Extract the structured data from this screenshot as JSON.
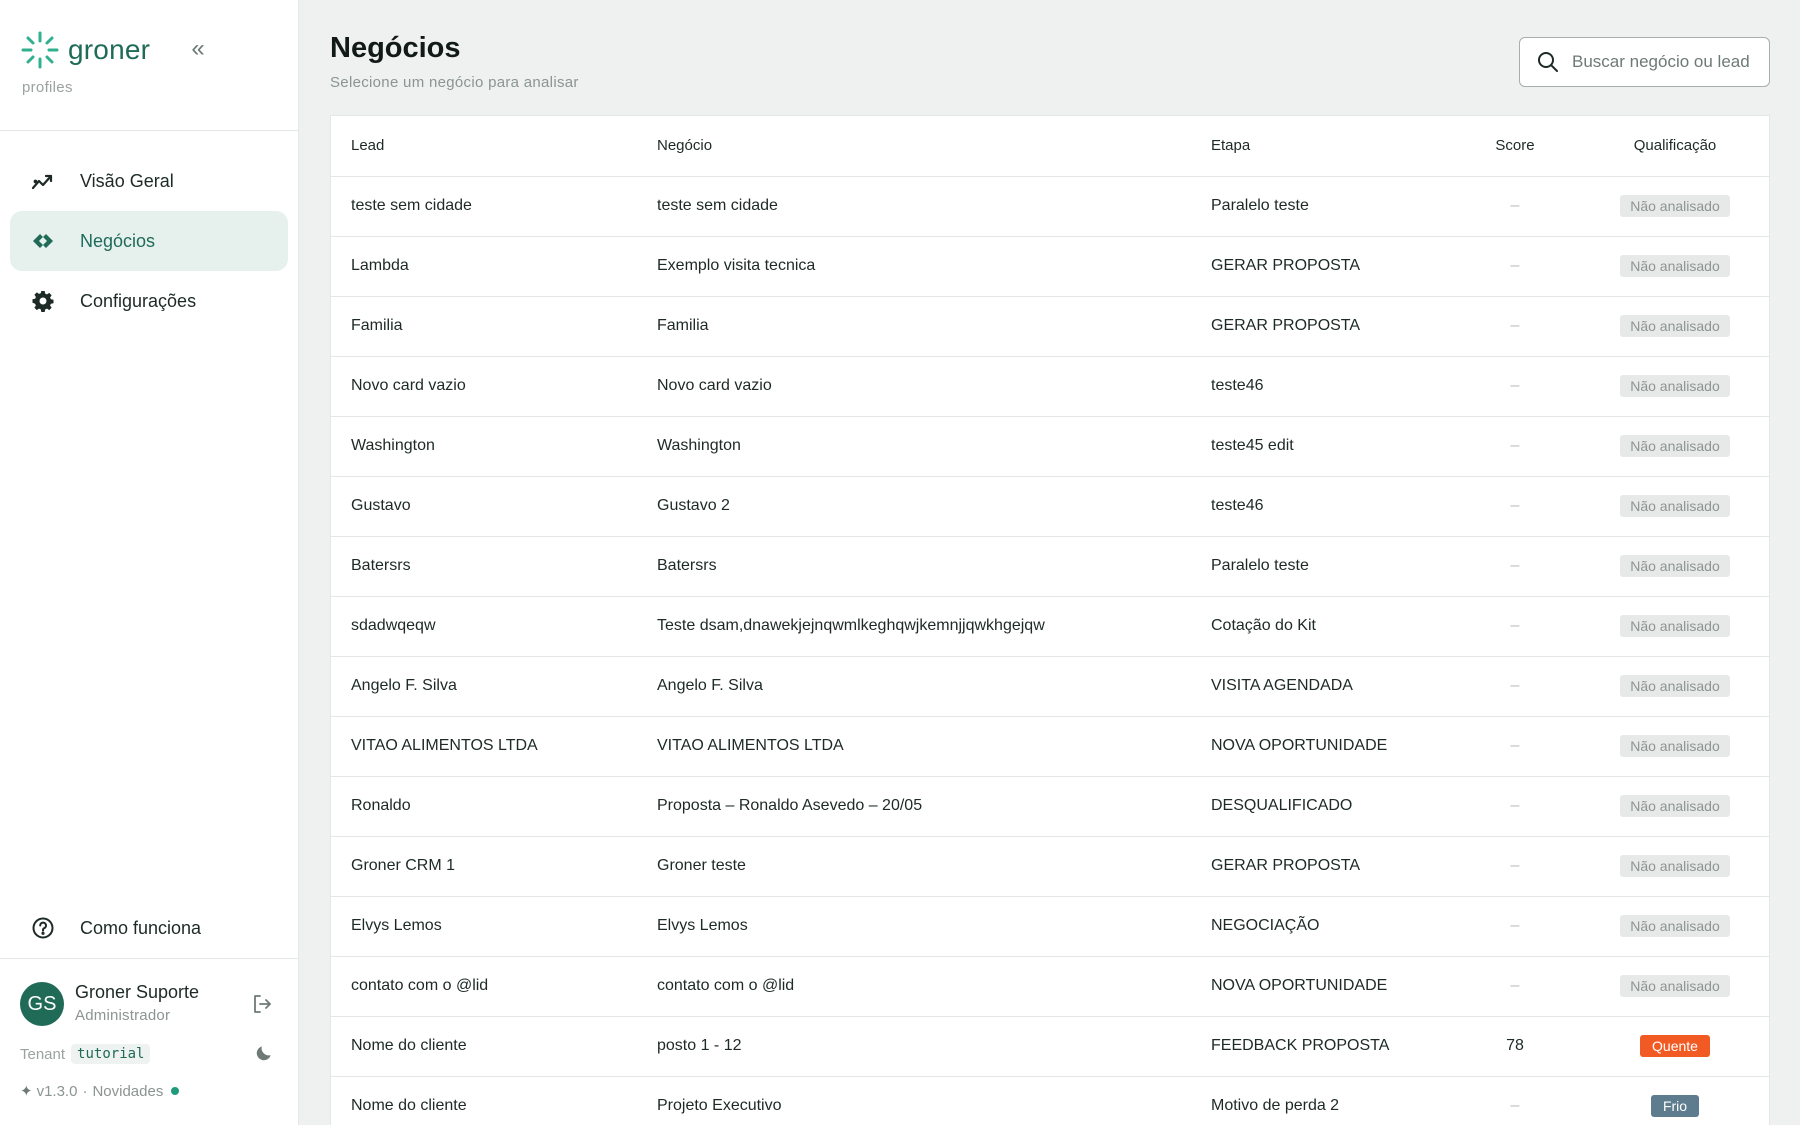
{
  "brand": {
    "name": "groner",
    "subtitle": "profiles",
    "collapse_icon": "«"
  },
  "nav": {
    "items": [
      {
        "label": "Visão Geral",
        "icon": "trend-chart-icon",
        "active": false
      },
      {
        "label": "Negócios",
        "icon": "handshake-icon",
        "active": true
      },
      {
        "label": "Configurações",
        "icon": "gear-icon",
        "active": false
      }
    ],
    "help": {
      "label": "Como funciona",
      "icon": "help-circle-icon"
    }
  },
  "user": {
    "initials": "GS",
    "name": "Groner Suporte",
    "role": "Administrador"
  },
  "tenant": {
    "label": "Tenant",
    "code": "tutorial"
  },
  "version": {
    "text": "v1.3.0",
    "separator": "·",
    "news": "Novidades"
  },
  "page": {
    "title": "Negócios",
    "subtitle": "Selecione um negócio para analisar"
  },
  "search": {
    "placeholder": "Buscar negócio ou lead",
    "value": ""
  },
  "table": {
    "columns": [
      "Lead",
      "Negócio",
      "Etapa",
      "Score",
      "Qualificação"
    ],
    "rows": [
      {
        "lead": "teste sem cidade",
        "negocio": "teste sem cidade",
        "etapa": "Paralelo teste",
        "score": "–",
        "qualificacao": "Não analisado",
        "status": "neutral"
      },
      {
        "lead": "Lambda",
        "negocio": "Exemplo visita tecnica",
        "etapa": "GERAR PROPOSTA",
        "score": "–",
        "qualificacao": "Não analisado",
        "status": "neutral"
      },
      {
        "lead": "Familia",
        "negocio": "Familia",
        "etapa": "GERAR PROPOSTA",
        "score": "–",
        "qualificacao": "Não analisado",
        "status": "neutral"
      },
      {
        "lead": "Novo card vazio",
        "negocio": "Novo card vazio",
        "etapa": "teste46",
        "score": "–",
        "qualificacao": "Não analisado",
        "status": "neutral"
      },
      {
        "lead": "Washington",
        "negocio": "Washington",
        "etapa": "teste45 edit",
        "score": "–",
        "qualificacao": "Não analisado",
        "status": "neutral"
      },
      {
        "lead": "Gustavo",
        "negocio": "Gustavo 2",
        "etapa": "teste46",
        "score": "–",
        "qualificacao": "Não analisado",
        "status": "neutral"
      },
      {
        "lead": "Batersrs",
        "negocio": "Batersrs",
        "etapa": "Paralelo teste",
        "score": "–",
        "qualificacao": "Não analisado",
        "status": "neutral"
      },
      {
        "lead": "sdadwqeqw",
        "negocio": "Teste dsam,dnawekjejnqwmlkeghqwjkemnjjqwkhgejqw",
        "etapa": "Cotação do Kit",
        "score": "–",
        "qualificacao": "Não analisado",
        "status": "neutral"
      },
      {
        "lead": "Angelo F. Silva",
        "negocio": "Angelo F. Silva",
        "etapa": "VISITA AGENDADA",
        "score": "–",
        "qualificacao": "Não analisado",
        "status": "neutral"
      },
      {
        "lead": "VITAO ALIMENTOS LTDA",
        "negocio": "VITAO ALIMENTOS LTDA",
        "etapa": "NOVA OPORTUNIDADE",
        "score": "–",
        "qualificacao": "Não analisado",
        "status": "neutral"
      },
      {
        "lead": "Ronaldo",
        "negocio": "Proposta – Ronaldo Asevedo – 20/05",
        "etapa": "DESQUALIFICADO",
        "score": "–",
        "qualificacao": "Não analisado",
        "status": "neutral"
      },
      {
        "lead": "Groner CRM 1",
        "negocio": "Groner teste",
        "etapa": "GERAR PROPOSTA",
        "score": "–",
        "qualificacao": "Não analisado",
        "status": "neutral"
      },
      {
        "lead": "Elvys Lemos",
        "negocio": "Elvys Lemos",
        "etapa": "NEGOCIAÇÃO",
        "score": "–",
        "qualificacao": "Não analisado",
        "status": "neutral"
      },
      {
        "lead": "contato com o @lid",
        "negocio": "contato com o @lid",
        "etapa": "NOVA OPORTUNIDADE",
        "score": "–",
        "qualificacao": "Não analisado",
        "status": "neutral"
      },
      {
        "lead": "Nome do cliente",
        "negocio": "posto 1 - 12",
        "etapa": "FEEDBACK PROPOSTA",
        "score": "78",
        "qualificacao": "Quente",
        "status": "hot"
      },
      {
        "lead": "Nome do cliente",
        "negocio": "Projeto Executivo",
        "etapa": "Motivo de perda 2",
        "score": "–",
        "qualificacao": "Frio",
        "status": "cold"
      }
    ]
  },
  "colors": {
    "accent": "#1f6b57",
    "active_bg": "#e6f1ee",
    "hot": "#f25a24",
    "cold": "#5d7d8f",
    "neutral_badge": "#e7e9e8"
  }
}
